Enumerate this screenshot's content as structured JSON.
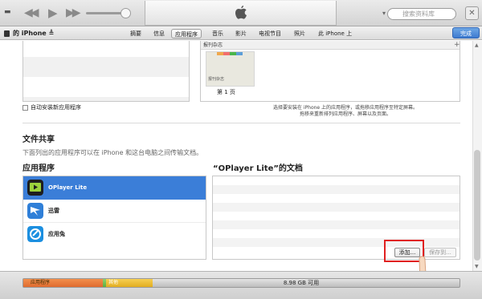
{
  "toolbar": {
    "prev": "◀◀",
    "play": "▶",
    "next": "▶▶",
    "search_placeholder": "搜索资料库",
    "close": "✕"
  },
  "nav": {
    "device_name": "的 iPhone ≜",
    "tabs": [
      "摘要",
      "信息",
      "应用程序",
      "音乐",
      "影片",
      "电视节目",
      "照片",
      "此 iPhone 上"
    ],
    "active_tab": "应用程序",
    "done_label": "完成"
  },
  "apps_section": {
    "auto_install_label": "自动安装新应用程序",
    "screen_panel_header": "报刊杂志",
    "thumb_label": "报刊杂志",
    "page_label": "第 1 页",
    "screen_desc_line1": "选择要安装在 iPhone 上的应用程序，或拖移应用程序至特定屏幕。",
    "screen_desc_line2": "拖移来重新排列应用程序、屏幕以及页面。"
  },
  "file_sharing": {
    "title": "文件共享",
    "description": "下面列出的应用程序可以在 iPhone 和这台电脑之间传输文档。",
    "apps_heading": "应用程序",
    "docs_heading": "“OPlayer Lite”的文档",
    "apps": [
      {
        "name": "OPlayer Lite",
        "icon": "oplayer-icon"
      },
      {
        "name": "迅雷",
        "icon": "xunlei-icon"
      },
      {
        "name": "应用兔",
        "icon": "yingyongtu-icon"
      }
    ],
    "add_button": "添加...",
    "save_button": "保存到..."
  },
  "capacity": {
    "apps_label": "应用程序",
    "other_label": "其他",
    "free_label": "8.98 GB 可用",
    "colors": {
      "apps": "#df6b2e",
      "other": "#e2ad20",
      "free": "#c8c8c8"
    }
  },
  "colors": {
    "accent": "#3b7ed8",
    "highlight": "#e02020"
  }
}
